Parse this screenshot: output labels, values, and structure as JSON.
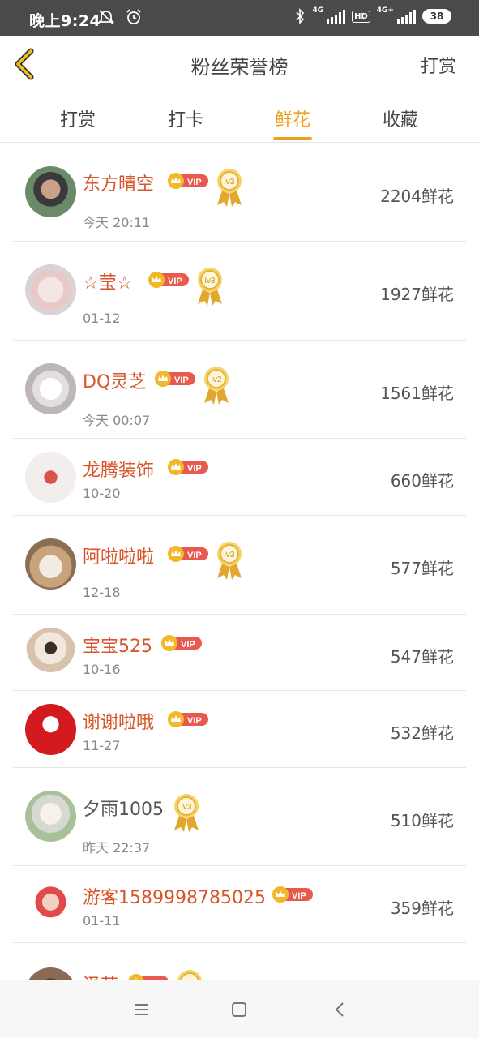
{
  "status_bar": {
    "time": "晚上9:24",
    "network": "4G",
    "network2": "4G+",
    "hd": "HD",
    "battery": "38"
  },
  "header": {
    "title": "粉丝荣誉榜",
    "action": "打赏"
  },
  "tabs": [
    {
      "label": "打赏",
      "active": false
    },
    {
      "label": "打卡",
      "active": false
    },
    {
      "label": "鲜花",
      "active": true
    },
    {
      "label": "收藏",
      "active": false
    }
  ],
  "vip_label": "VIP",
  "rows": [
    {
      "name": "东方晴空",
      "date": "今天 20:11",
      "amount": "2204鲜花",
      "vip": true,
      "medal": "lv3"
    },
    {
      "name": "☆莹☆",
      "date": "01-12",
      "amount": "1927鲜花",
      "vip": true,
      "medal": "lv3"
    },
    {
      "name": "DQ灵芝",
      "date": "今天 00:07",
      "amount": "1561鲜花",
      "vip": true,
      "medal": "lv2"
    },
    {
      "name": "龙腾装饰",
      "date": "10-20",
      "amount": "660鲜花",
      "vip": true,
      "medal": ""
    },
    {
      "name": "阿啦啦啦",
      "date": "12-18",
      "amount": "577鲜花",
      "vip": true,
      "medal": "lv3"
    },
    {
      "name": "宝宝525",
      "date": "10-16",
      "amount": "547鲜花",
      "vip": true,
      "medal": ""
    },
    {
      "name": "谢谢啦哦",
      "date": "11-27",
      "amount": "532鲜花",
      "vip": true,
      "medal": ""
    },
    {
      "name": "夕雨1005",
      "date": "昨天 22:37",
      "amount": "510鲜花",
      "vip": false,
      "medal": "lv3"
    },
    {
      "name": "游客1589998785025",
      "date": "01-11",
      "amount": "359鲜花",
      "vip": true,
      "medal": ""
    },
    {
      "name": "泽芸",
      "date": "",
      "amount": "",
      "vip": true,
      "medal": "lv3"
    }
  ],
  "colors": {
    "accent": "#f0a020",
    "name_vip": "#d8542a",
    "vip_badge": "#e85a4f",
    "medal_gold": "#e8b33a"
  },
  "icons": {
    "back": "chevron-left-icon",
    "vip_crown": "crown-icon",
    "medal": "medal-icon",
    "nav_menu": "menu-icon",
    "nav_home": "home-square-icon",
    "nav_back": "back-chevron-icon"
  }
}
